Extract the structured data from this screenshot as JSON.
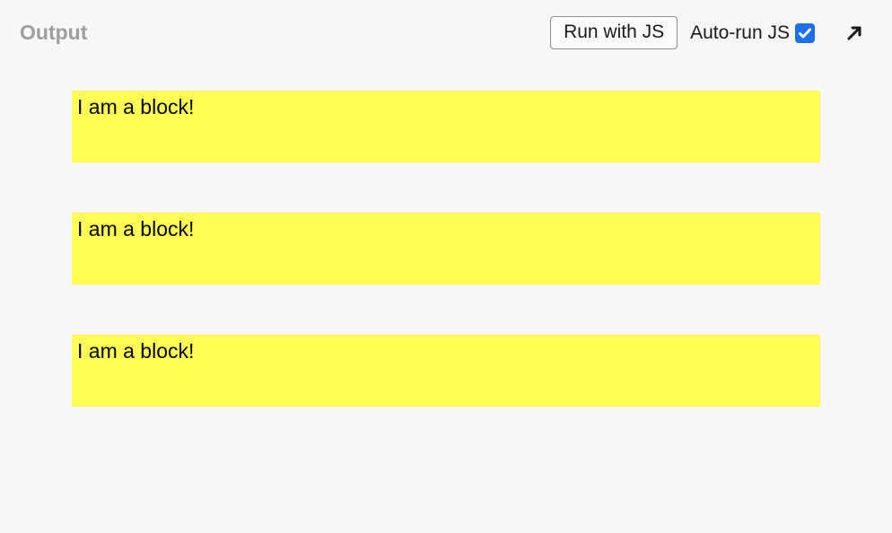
{
  "header": {
    "title": "Output",
    "run_button": "Run with JS",
    "autorun_label": "Auto-run JS",
    "autorun_checked": true
  },
  "content": {
    "blocks": [
      {
        "text": "I am a block!"
      },
      {
        "text": "I am a block!"
      },
      {
        "text": "I am a block!"
      }
    ]
  }
}
